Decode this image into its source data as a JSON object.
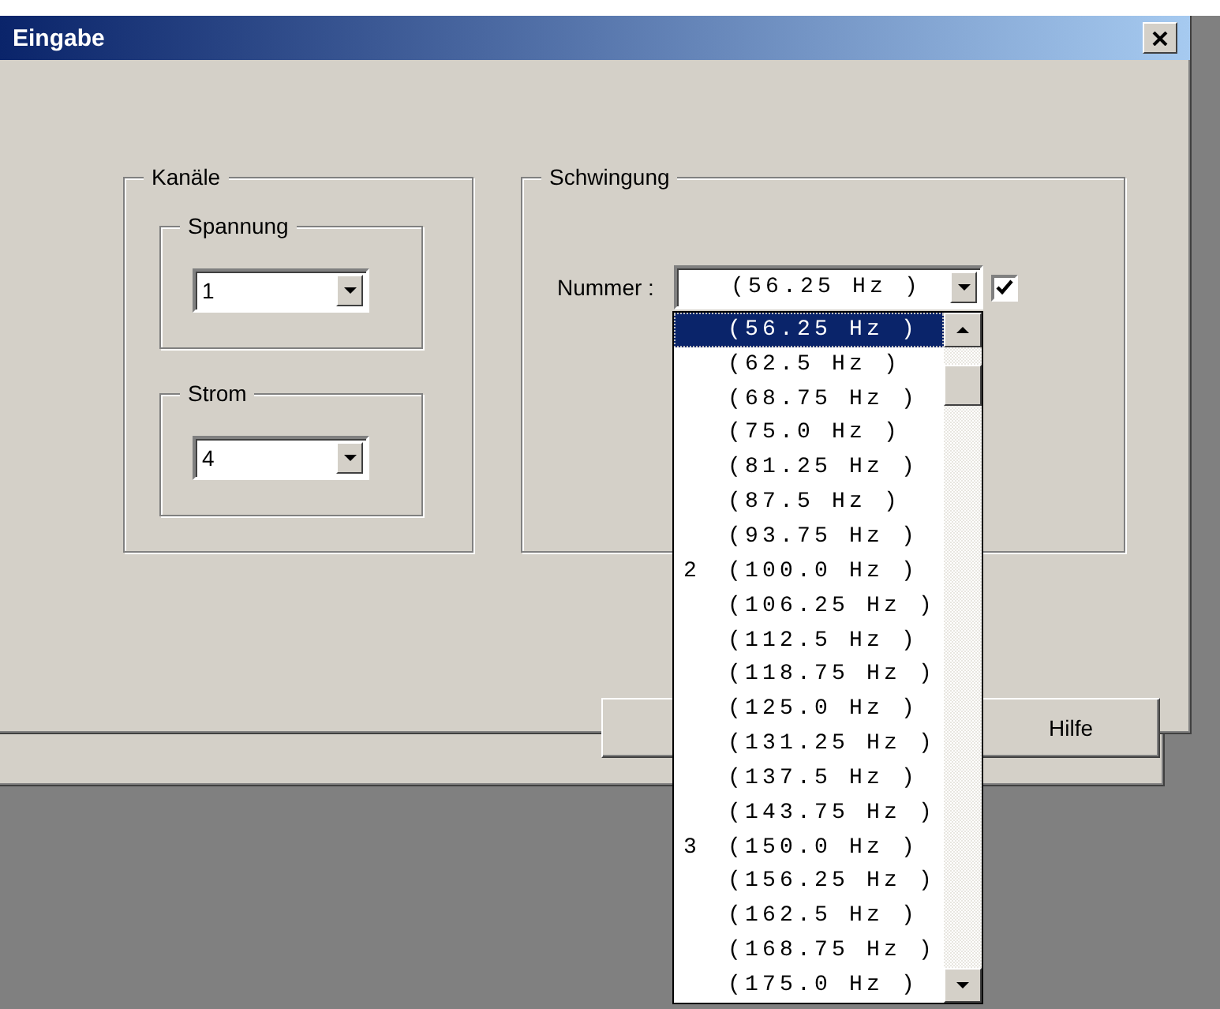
{
  "window": {
    "title": "Eingabe"
  },
  "kanaele": {
    "title": "Kanäle",
    "groups": [
      {
        "title": "Spannung",
        "value": "1"
      },
      {
        "title": "Strom",
        "value": "4"
      }
    ]
  },
  "schwingung": {
    "title": "Schwingung",
    "label": "Nummer :",
    "value": "(56.25 Hz )",
    "checked": true
  },
  "dropdown": {
    "items": [
      {
        "text": "(56.25 Hz )",
        "selected": true
      },
      {
        "text": "(62.5 Hz )",
        "selected": false
      },
      {
        "text": "(68.75 Hz )",
        "selected": false
      },
      {
        "text": "(75.0 Hz )",
        "selected": false
      },
      {
        "text": "(81.25 Hz )",
        "selected": false
      },
      {
        "text": "(87.5 Hz )",
        "selected": false
      },
      {
        "text": "(93.75 Hz )",
        "selected": false
      },
      {
        "number": "2",
        "text": "(100.0 Hz )",
        "selected": false
      },
      {
        "text": "(106.25 Hz )",
        "selected": false
      },
      {
        "text": "(112.5 Hz )",
        "selected": false
      },
      {
        "text": "(118.75 Hz )",
        "selected": false
      },
      {
        "text": "(125.0 Hz )",
        "selected": false
      },
      {
        "text": "(131.25 Hz )",
        "selected": false
      },
      {
        "text": "(137.5 Hz )",
        "selected": false
      },
      {
        "text": "(143.75 Hz )",
        "selected": false
      },
      {
        "number": "3",
        "text": "(150.0 Hz )",
        "selected": false
      },
      {
        "text": "(156.25 Hz )",
        "selected": false
      },
      {
        "text": "(162.5 Hz )",
        "selected": false
      },
      {
        "text": "(168.75 Hz )",
        "selected": false
      },
      {
        "text": "(175.0 Hz )",
        "selected": false
      }
    ]
  },
  "buttons": [
    {
      "label": "Hilfe"
    }
  ]
}
